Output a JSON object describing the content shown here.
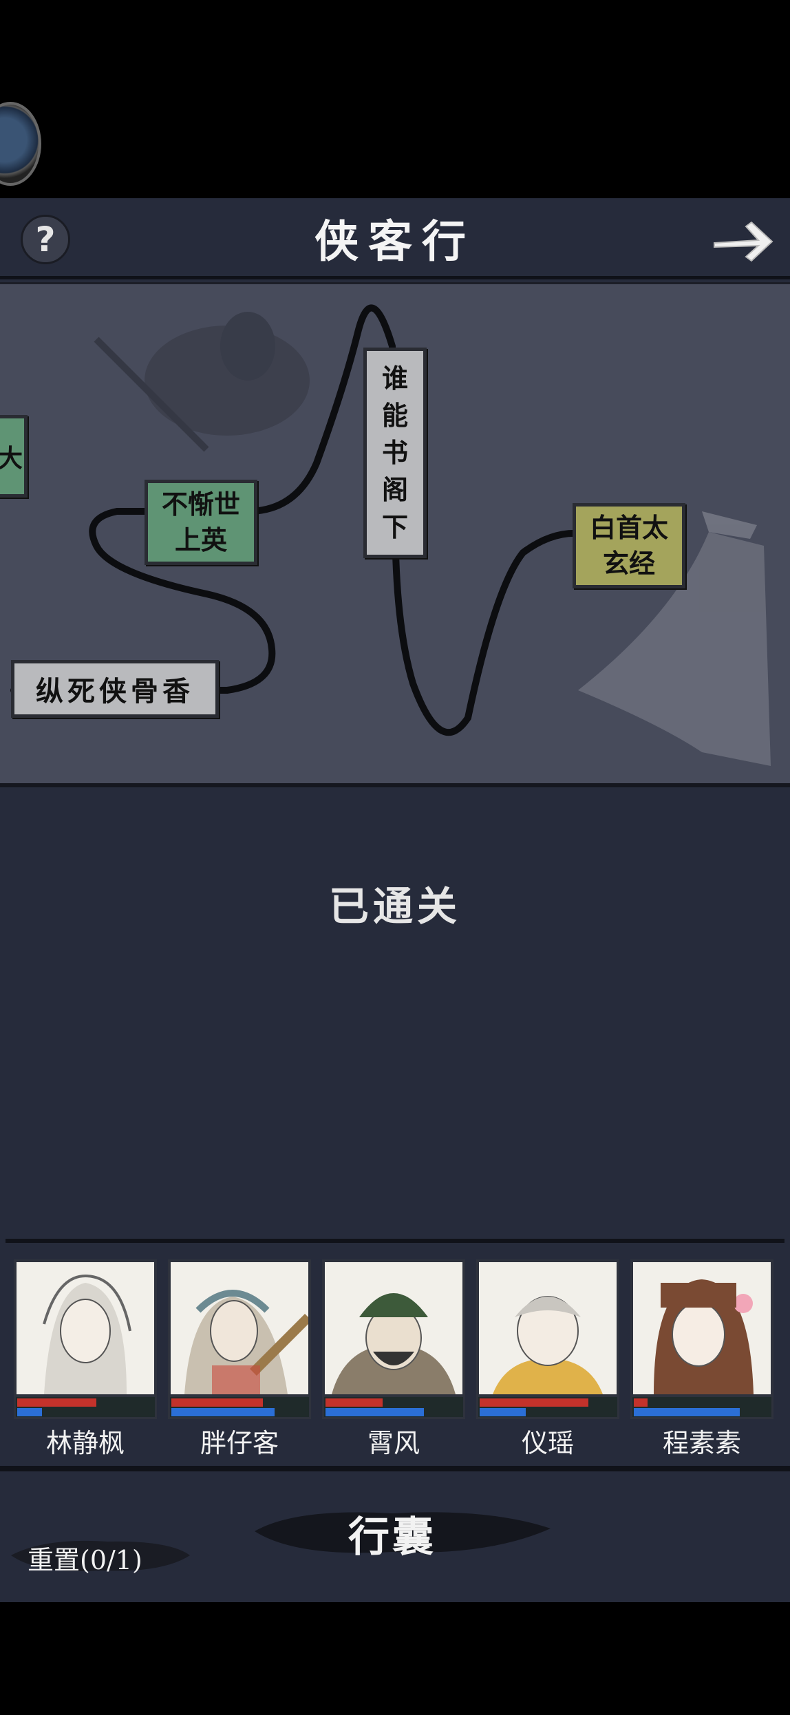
{
  "header": {
    "title": "侠客行",
    "help_label": "?"
  },
  "map": {
    "nodes": [
      {
        "id": "partial",
        "label": "大"
      },
      {
        "id": "bu-can",
        "line1": "不惭世",
        "line2": "上英"
      },
      {
        "id": "shui-neng",
        "c1": "谁",
        "c2": "能",
        "c3": "书",
        "c4": "阁",
        "c5": "下"
      },
      {
        "id": "bai-shou",
        "line1": "白首太",
        "line2": "玄经"
      },
      {
        "id": "zong-si",
        "label": "纵死侠骨香"
      }
    ]
  },
  "status": "已通关",
  "party": [
    {
      "name": "林静枫",
      "hp": 0.58,
      "mp": 0.18
    },
    {
      "name": "胖仔客",
      "hp": 0.67,
      "mp": 0.76
    },
    {
      "name": "霄风",
      "hp": 0.42,
      "mp": 0.72
    },
    {
      "name": "仪瑶",
      "hp": 0.8,
      "mp": 0.34
    },
    {
      "name": "程素素",
      "hp": 0.1,
      "mp": 0.78
    }
  ],
  "footer": {
    "bag_label": "行囊",
    "reset_label": "重置(0/1)"
  },
  "colors": {
    "panel": "#262b3b",
    "map": "#474b5b",
    "green_node": "#5f9474",
    "gray_node": "#b9babd",
    "olive_node": "#a4a45c",
    "hp": "#c4322b",
    "mp": "#2b6fd6"
  }
}
